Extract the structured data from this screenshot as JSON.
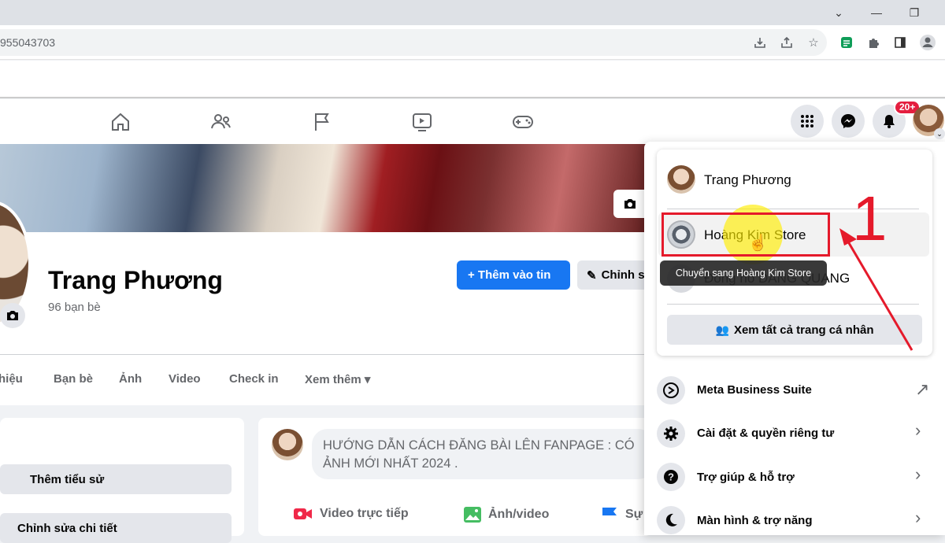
{
  "browser": {
    "url_fragment": "955043703",
    "win_controls": [
      "chevron-down",
      "minimize",
      "restore"
    ]
  },
  "header": {
    "nav_icons": [
      "home-icon",
      "friends-icon",
      "pages-flag-icon",
      "watch-icon",
      "gaming-icon"
    ],
    "notification_badge": "20+"
  },
  "profile": {
    "name": "Trang Phương",
    "friends_count": "96 bạn bè",
    "add_story_label": "+ Thêm vào tin",
    "edit_label": "Chỉnh s",
    "tabs": [
      "hiệu",
      "Bạn bè",
      "Ảnh",
      "Video",
      "Check in",
      "Xem thêm ▾"
    ]
  },
  "left_card": {
    "add_bio": "Thêm tiểu sử",
    "edit_details": "Chỉnh sửa chi tiết"
  },
  "post_composer": {
    "text": "HƯỚNG DẪN CÁCH ĐĂNG BÀI LÊN FANPAGE : CÓ ẢNH MỚI NHẤT 2024 .",
    "actions": [
      "Video trực tiếp",
      "Ảnh/video",
      "Sự"
    ]
  },
  "dropdown": {
    "current_profile": "Trang Phương",
    "page_profile": "Hoàng Kim Store",
    "third_profile": "Đồng hồ DANG QUANG",
    "tooltip": "Chuyển sang Hoàng Kim Store",
    "see_all": "Xem tất cả trang cá nhân",
    "menu": [
      {
        "label": "Meta Business Suite",
        "trail": "↗"
      },
      {
        "label": "Cài đặt & quyền riêng tư",
        "trail": "›"
      },
      {
        "label": "Trợ giúp & hỗ trợ",
        "trail": "›"
      },
      {
        "label": "Màn hình & trợ năng",
        "trail": "›"
      }
    ]
  },
  "annotation": {
    "step_number": "1",
    "color": "#e51a2b"
  }
}
